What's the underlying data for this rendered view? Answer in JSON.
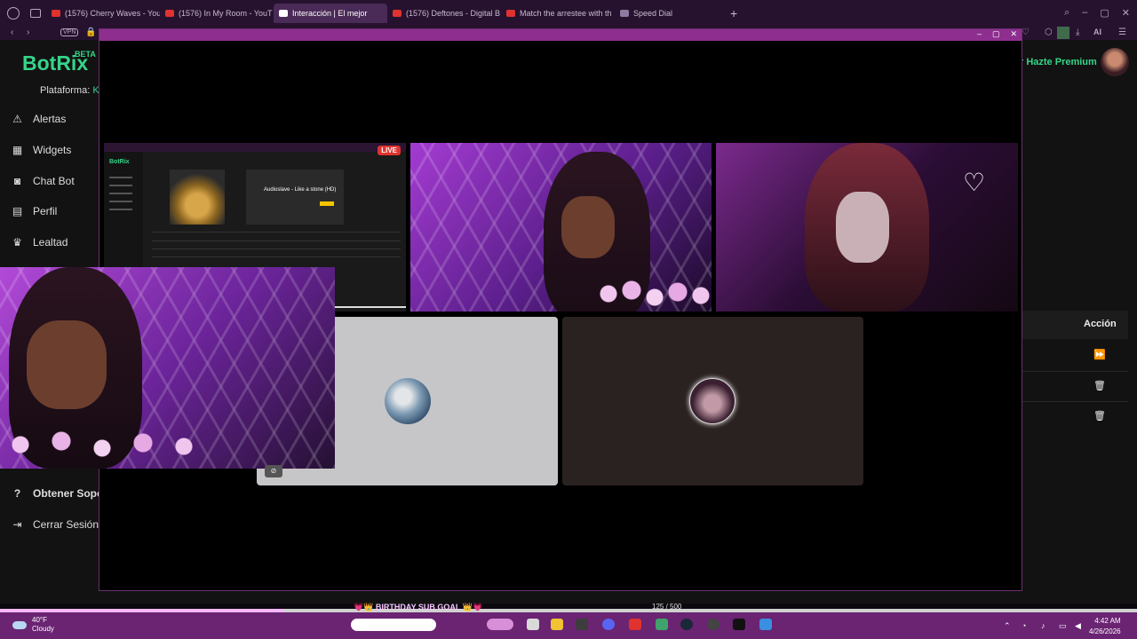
{
  "browser": {
    "tabs": [
      {
        "label": "(1576) Cherry Waves - You",
        "fav_color": "#e0322f"
      },
      {
        "label": "(1576) In My Room - YouT",
        "fav_color": "#e0322f"
      },
      {
        "label": "Interacción | El mejor",
        "fav_color": "#ffffff"
      },
      {
        "label": "(1576) Deftones - Digital B",
        "fav_color": "#e0322f"
      },
      {
        "label": "Match the arrestee with th",
        "fav_color": "#e0322f"
      },
      {
        "label": "Speed Dial",
        "fav_color": "#8c7aa0"
      }
    ],
    "vpn_label": "VPN",
    "ai_label": "AI"
  },
  "botrix": {
    "brand": "BotRix",
    "beta": "BETA",
    "platform_label": "Plataforma:",
    "platform_value": "K",
    "premium": "r Hazte Premium",
    "nav": [
      {
        "label": "Alertas",
        "icon": "warning-icon"
      },
      {
        "label": "Widgets",
        "icon": "grid-icon"
      },
      {
        "label": "Chat Bot",
        "icon": "robot-icon"
      },
      {
        "label": "Perfil",
        "icon": "profile-card-icon"
      },
      {
        "label": "Lealtad",
        "icon": "trophy-icon"
      }
    ],
    "nav_bottom": [
      {
        "label": "Obtener Sopor",
        "icon": "help-icon"
      },
      {
        "label": "Cerrar Sesión",
        "icon": "logout-icon"
      }
    ],
    "table_header": "Acción"
  },
  "screenshare": {
    "live": "LIVE",
    "brand": "BotRix",
    "song_title": "Audioslave - Like a stone (HD)"
  },
  "stream": {
    "goal": "💗👑 BIRTHDAY SUB GOAL 👑💗",
    "goal_count": "125 / 500",
    "goal_progress": 0.25
  },
  "taskbar": {
    "temp": "40°F",
    "condition": "Cloudy",
    "time": "4:42 AM",
    "date": "4/26/2026"
  },
  "colors": {
    "brand_green": "#35d58a",
    "popup_titlebar": "#8e2f8f",
    "taskbar": "#6a2472"
  }
}
